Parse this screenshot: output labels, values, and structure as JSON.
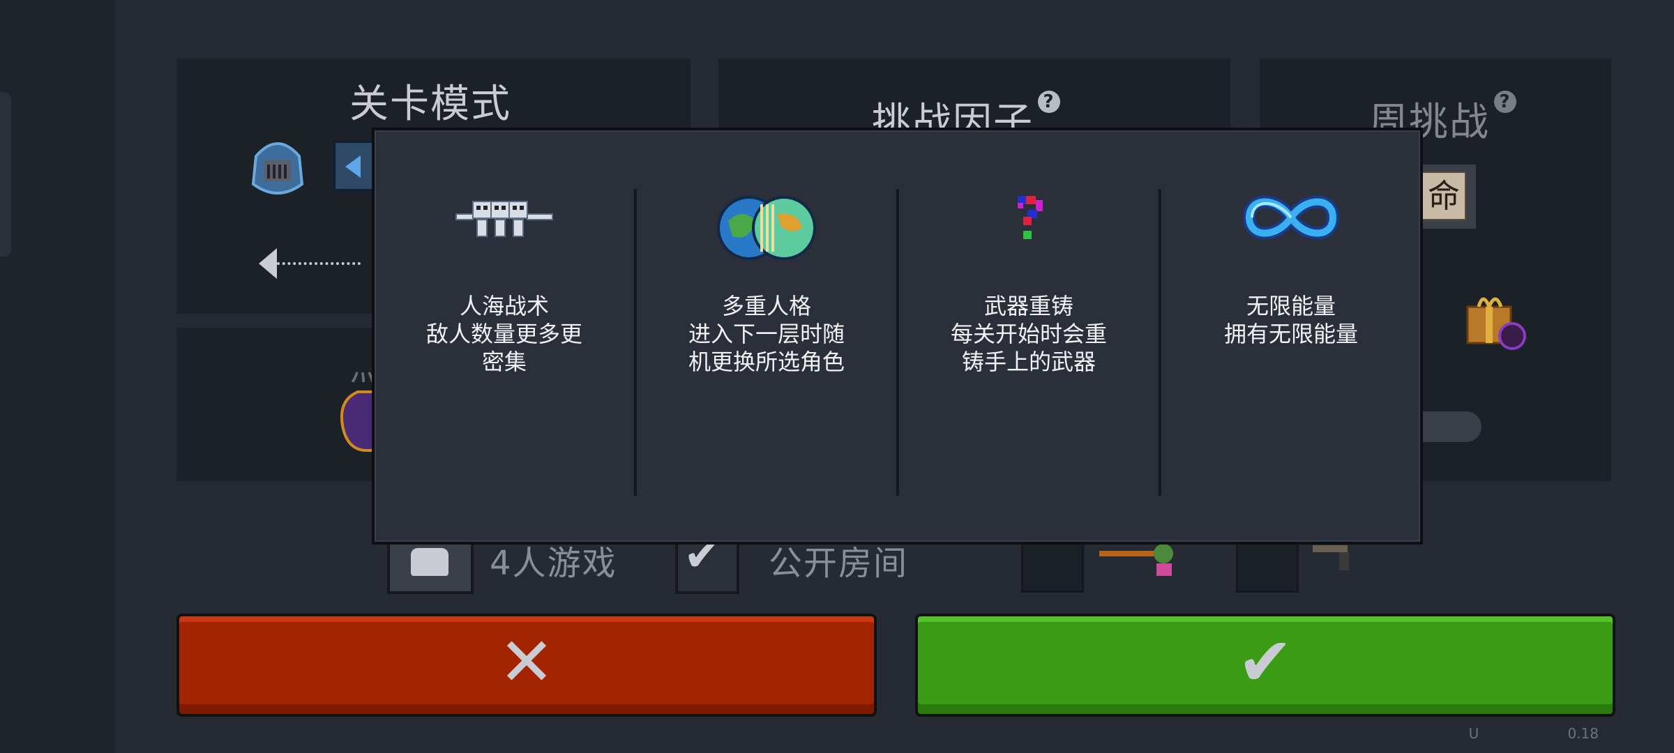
{
  "background_panels": {
    "level_mode": {
      "title": "关卡模式"
    },
    "challenge_factor": {
      "title": "挑战因子",
      "help": "?"
    },
    "weekly_challenge": {
      "title": "周挑战",
      "help": "?",
      "badge": "命"
    }
  },
  "lobby_row": {
    "players_label": "4人游戏",
    "public_room_label": "公开房间",
    "public_room_checked": true
  },
  "overlay": {
    "factors": [
      {
        "icon": "skeleton-horde-icon",
        "name": "人海战术",
        "desc_lines": [
          "敌人数量更多更",
          "密集"
        ]
      },
      {
        "icon": "split-planet-icon",
        "name": "多重人格",
        "desc_lines": [
          "进入下一层时随",
          "机更换所选角色"
        ]
      },
      {
        "icon": "glitch-question-icon",
        "name": "武器重铸",
        "desc_lines": [
          "每关开始时会重",
          "铸手上的武器"
        ]
      },
      {
        "icon": "infinity-icon",
        "name": "无限能量",
        "desc_lines": [
          "拥有无限能量"
        ]
      }
    ]
  },
  "buttons": {
    "cancel_glyph": "✕",
    "confirm_glyph": "✔"
  },
  "version_text": "U                    0.18",
  "colors": {
    "cancel": "#a32400",
    "confirm": "#3a9b14",
    "overlay_bg": "#2a2f39"
  }
}
